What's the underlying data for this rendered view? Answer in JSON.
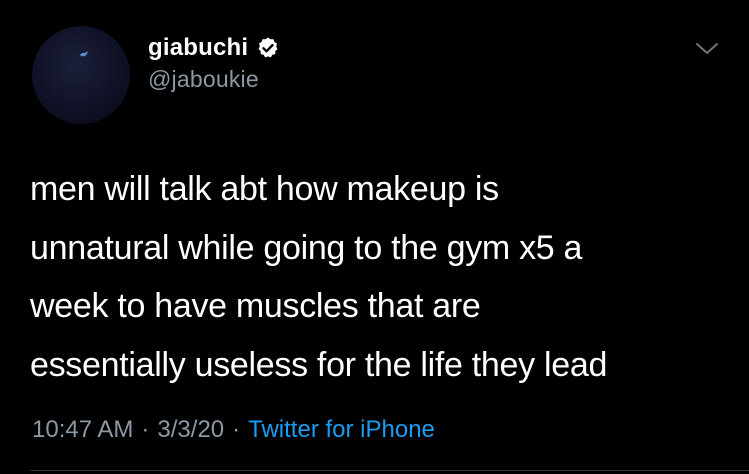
{
  "tweet": {
    "display_name": "giabuchi",
    "handle": "@jaboukie",
    "text": "men will talk abt how makeup is\nunnatural while going to the gym x5 a\nweek to have muscles that are\nessentially useless for the life they lead",
    "time": "10:47 AM",
    "date": "3/3/20",
    "separator": "·",
    "source": "Twitter for iPhone",
    "verified": true
  },
  "icons": {
    "verified": "verified-badge-icon",
    "menu": "chevron-down-icon"
  },
  "colors": {
    "background": "#000000",
    "text": "#ffffff",
    "secondary": "#8b98a5",
    "link": "#1d9bf0"
  }
}
